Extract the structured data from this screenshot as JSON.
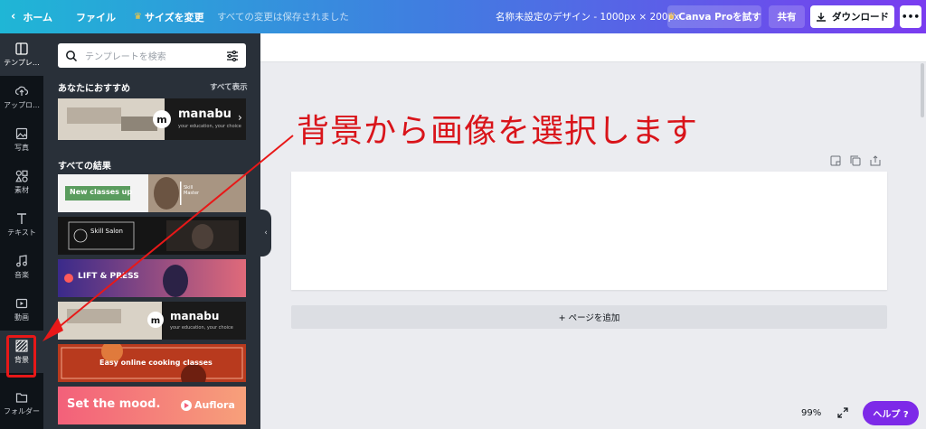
{
  "topbar": {
    "home": "ホーム",
    "file": "ファイル",
    "resize": "サイズを変更",
    "saved": "すべての変更は保存されました",
    "doc_name": "名称未設定のデザイン - 1000px × 200px",
    "pro_button": "Canva Proを試す",
    "share_button": "共有",
    "download_button": "ダウンロード",
    "more_button": "•••"
  },
  "rail": {
    "items": [
      {
        "label": "テンプレ…",
        "icon": "template-icon"
      },
      {
        "label": "アップロ…",
        "icon": "upload-icon"
      },
      {
        "label": "写真",
        "icon": "photo-icon"
      },
      {
        "label": "素材",
        "icon": "elements-icon"
      },
      {
        "label": "テキスト",
        "icon": "text-icon"
      },
      {
        "label": "音楽",
        "icon": "music-icon"
      },
      {
        "label": "動画",
        "icon": "video-icon"
      },
      {
        "label": "背景",
        "icon": "background-icon"
      },
      {
        "label": "フォルダー",
        "icon": "folder-icon"
      }
    ]
  },
  "panel": {
    "search_placeholder": "テンプレートを検索",
    "recommended_title": "あなたにおすすめ",
    "see_all": "すべて表示",
    "all_results_title": "すべての結果",
    "templates": [
      {
        "main": "manabu",
        "sub": "your education, your choice"
      },
      {
        "main": "New classes up",
        "sub": "Skill Master"
      },
      {
        "main": "Skill Salon",
        "sub": ""
      },
      {
        "main": "LIFT & PRESS",
        "sub": ""
      },
      {
        "main": "manabu",
        "sub": "your education, your choice"
      },
      {
        "main": "Easy online cooking classes",
        "sub": ""
      },
      {
        "main": "Set the mood.",
        "sub": "Auflora"
      }
    ]
  },
  "canvas": {
    "annotation": "背景から画像を選択します",
    "add_page": "+ ページを追加",
    "zoom": "99%",
    "help": "ヘルプ ?"
  }
}
